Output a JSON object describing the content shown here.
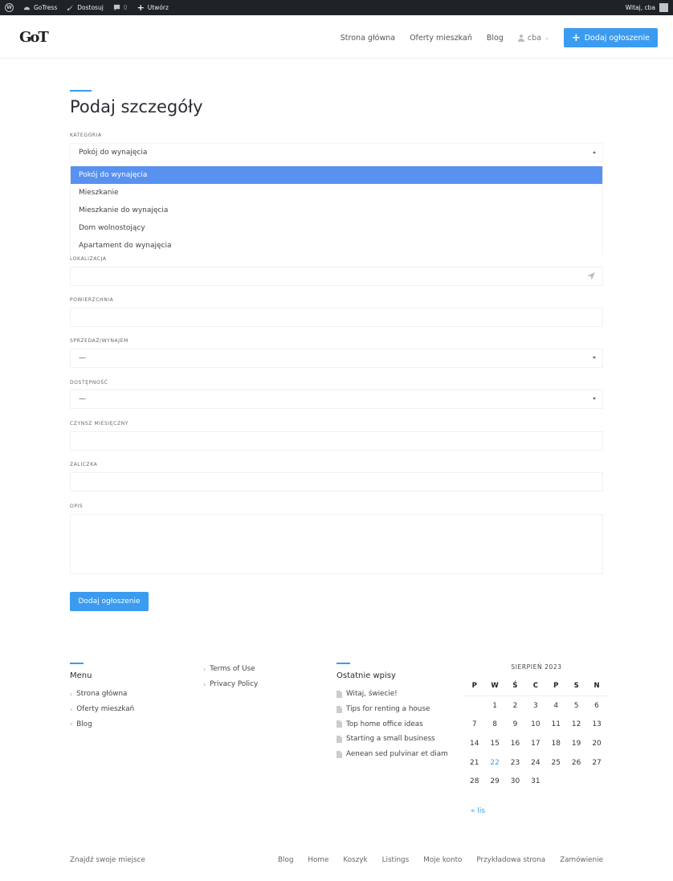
{
  "admin_bar": {
    "site_name": "GoTress",
    "customize": "Dostosuj",
    "comments_count": "0",
    "new": "Utwórz",
    "greeting": "Witaj, cba"
  },
  "header": {
    "logo": "GoT",
    "nav": [
      "Strona główna",
      "Oferty mieszkań",
      "Blog"
    ],
    "user": "cba",
    "add_button": "Dodaj ogłoszenie"
  },
  "form": {
    "title": "Podaj szczegóły",
    "category_label": "KATEGORIA",
    "category_value": "Pokój do wynajęcia",
    "category_options": [
      "Pokój do wynajęcia",
      "Mieszkanie",
      "Mieszkanie do wynajęcia",
      "Dom wolnostojący",
      "Apartament do wynajęcia"
    ],
    "location_label": "LOKALIZACJA",
    "area_label": "POWIERZCHNIA",
    "sale_rent_label": "SPRZEDAŻ/WYNAJEM",
    "sale_rent_value": "—",
    "availability_label": "DOSTĘPNOŚĆ",
    "availability_value": "—",
    "rent_label": "CZYNSZ MIESIĘCZNY",
    "deposit_label": "ZALICZKA",
    "description_label": "OPIS",
    "submit": "Dodaj ogłoszenie"
  },
  "footer": {
    "menu_title": "Menu",
    "menu_items": [
      "Strona główna",
      "Oferty mieszkań",
      "Blog"
    ],
    "extra_links": [
      "Terms of Use",
      "Privacy Policy"
    ],
    "posts_title": "Ostatnie wpisy",
    "posts": [
      "Witaj, świecie!",
      "Tips for renting a house",
      "Top home office ideas",
      "Starting a small business",
      "Aenean sed pulvinar et diam"
    ],
    "calendar": {
      "caption": "SIERPIEŃ 2023",
      "days": [
        "P",
        "W",
        "Ś",
        "C",
        "P",
        "S",
        "N"
      ],
      "weeks": [
        [
          "",
          "1",
          "2",
          "3",
          "4",
          "5",
          "6"
        ],
        [
          "7",
          "8",
          "9",
          "10",
          "11",
          "12",
          "13"
        ],
        [
          "14",
          "15",
          "16",
          "17",
          "18",
          "19",
          "20"
        ],
        [
          "21",
          "22",
          "23",
          "24",
          "25",
          "26",
          "27"
        ],
        [
          "28",
          "29",
          "30",
          "31",
          "",
          "",
          ""
        ]
      ],
      "today": "22",
      "prev": "« lis"
    },
    "tagline": "Znajdź swoje miejsce",
    "bottom_links": [
      "Blog",
      "Home",
      "Koszyk",
      "Listings",
      "Moje konto",
      "Przykładowa strona",
      "Zamówienie"
    ]
  },
  "colors": {
    "accent": "#3b9bf0",
    "selected_option": "#5891f0",
    "admin_bar": "#1d2327"
  }
}
